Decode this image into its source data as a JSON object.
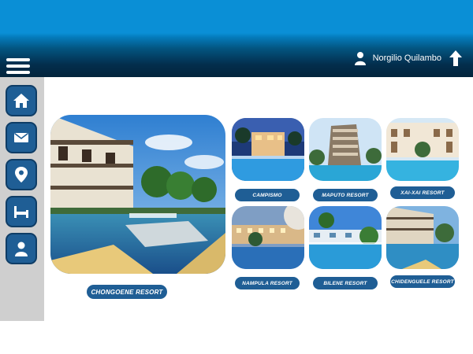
{
  "header": {
    "user_name": "Norgilio Quilambo",
    "menu_icon": "hamburger-menu-icon",
    "user_icon": "user-icon",
    "upload_icon": "up-arrow-icon",
    "colors": {
      "bar_top": "#0a8fd6",
      "bar_bottom": "#03243c"
    }
  },
  "sidebar": {
    "items": [
      {
        "name": "home",
        "icon": "home-icon"
      },
      {
        "name": "mail",
        "icon": "mail-icon"
      },
      {
        "name": "location",
        "icon": "location-pin-icon"
      },
      {
        "name": "bed",
        "icon": "bed-icon"
      },
      {
        "name": "profile",
        "icon": "profile-icon"
      }
    ],
    "accent": "#1f5e95"
  },
  "resorts": {
    "featured": {
      "label": "CHONGOENE RESORT"
    },
    "grid": [
      {
        "label": "CAMPISMO"
      },
      {
        "label": "MAPUTO RESORT"
      },
      {
        "label": "XAI-XAI RESORT"
      },
      {
        "label": "NAMPULA RESORT"
      },
      {
        "label": "BILENE RESORT"
      },
      {
        "label": "CHIDENGUELE RESORT"
      }
    ]
  }
}
